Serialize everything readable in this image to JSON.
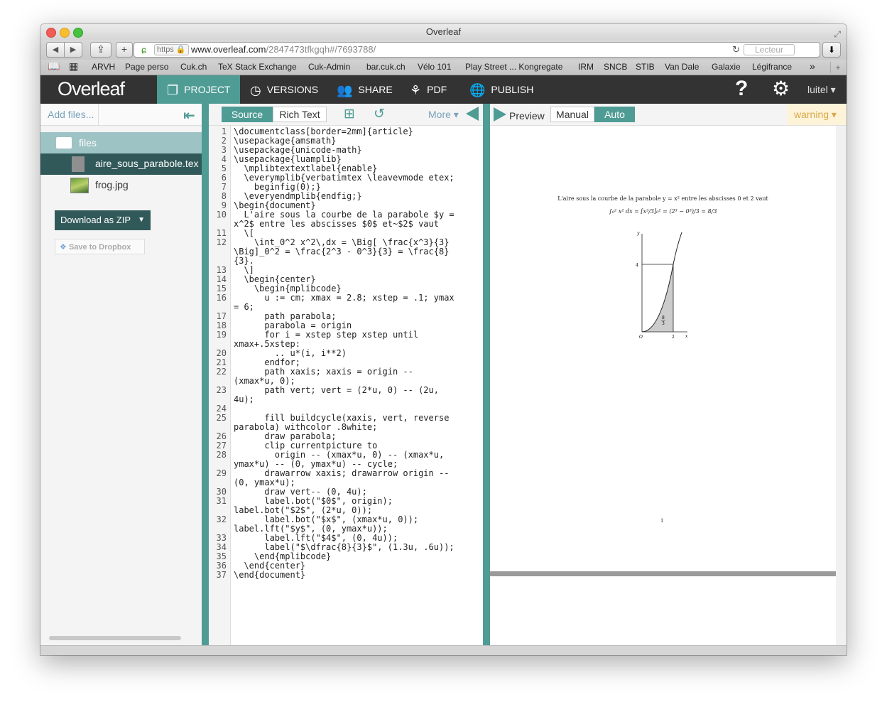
{
  "window": {
    "title": "Overleaf"
  },
  "browser": {
    "url_scheme": "https",
    "url_host": "www.overleaf.com",
    "url_path": "/2847473tfkgqh#/7693788/",
    "reader_label": "Lecteur",
    "bookmarks": [
      "ARVH",
      "Page perso",
      "Cuk.ch",
      "TeX Stack Exchange",
      "Cuk-Admin",
      "bar.cuk.ch",
      "Vélo 101",
      "Play Street ... Kongregate",
      "IRM",
      "SNCB",
      "STIB",
      "Van Dale",
      "Galaxie",
      "Légifrance"
    ]
  },
  "header": {
    "logo": "Overleaf",
    "nav": [
      {
        "label": "PROJECT",
        "icon": "project-icon"
      },
      {
        "label": "VERSIONS",
        "icon": "clock-icon"
      },
      {
        "label": "SHARE",
        "icon": "users-icon"
      },
      {
        "label": "PDF",
        "icon": "pdf-icon"
      },
      {
        "label": "PUBLISH",
        "icon": "globe-icon"
      }
    ],
    "user": "luitel"
  },
  "sidebar": {
    "add_files": "Add files...",
    "folder": "files",
    "files": [
      {
        "name": "aire_sous_parabole.tex",
        "selected": true
      },
      {
        "name": "frog.jpg",
        "selected": false
      }
    ],
    "download_zip": "Download as ZIP",
    "dropbox": "Save to Dropbox"
  },
  "editor": {
    "tab_source": "Source",
    "tab_rich": "Rich Text",
    "more": "More",
    "lines": [
      {
        "n": "1",
        "text": "\\documentclass[border=2mm]{article}"
      },
      {
        "n": "2",
        "text": "\\usepackage{amsmath}"
      },
      {
        "n": "3",
        "text": "\\usepackage{unicode-math}"
      },
      {
        "n": "4",
        "text": "\\usepackage{luamplib}"
      },
      {
        "n": "5",
        "text": "  \\mplibtextextlabel{enable}"
      },
      {
        "n": "6",
        "text": "  \\everymplib{verbatimtex \\leavevmode etex;"
      },
      {
        "n": "7",
        "text": "    beginfig(0);}"
      },
      {
        "n": "8",
        "text": "  \\everyendmplib{endfig;}"
      },
      {
        "n": "9",
        "text": "\\begin{document}"
      },
      {
        "n": "10",
        "text": "  L'aire sous la courbe de la parabole $y ="
      },
      {
        "n": "",
        "text": "x^2$ entre les abscisses $0$ et~$2$ vaut"
      },
      {
        "n": "11",
        "text": "  \\["
      },
      {
        "n": "12",
        "text": "    \\int_0^2 x^2\\,dx = \\Big[ \\frac{x^3}{3}"
      },
      {
        "n": "",
        "text": "\\Big]_0^2 = \\frac{2^3 - 0^3}{3} = \\frac{8}"
      },
      {
        "n": "",
        "text": "{3}."
      },
      {
        "n": "13",
        "text": "  \\]"
      },
      {
        "n": "14",
        "text": "  \\begin{center}"
      },
      {
        "n": "15",
        "text": "    \\begin{mplibcode}"
      },
      {
        "n": "16",
        "text": "      u := cm; xmax = 2.8; xstep = .1; ymax"
      },
      {
        "n": "",
        "text": "= 6;"
      },
      {
        "n": "17",
        "text": "      path parabola;"
      },
      {
        "n": "18",
        "text": "      parabola = origin"
      },
      {
        "n": "19",
        "text": "      for i = xstep step xstep until"
      },
      {
        "n": "",
        "text": "xmax+.5xstep:"
      },
      {
        "n": "20",
        "text": "        .. u*(i, i**2)"
      },
      {
        "n": "21",
        "text": "      endfor;"
      },
      {
        "n": "22",
        "text": "      path xaxis; xaxis = origin --"
      },
      {
        "n": "",
        "text": "(xmax*u, 0);"
      },
      {
        "n": "23",
        "text": "      path vert; vert = (2*u, 0) -- (2u,"
      },
      {
        "n": "",
        "text": "4u);"
      },
      {
        "n": "24",
        "text": ""
      },
      {
        "n": "25",
        "text": "      fill buildcycle(xaxis, vert, reverse"
      },
      {
        "n": "",
        "text": "parabola) withcolor .8white;"
      },
      {
        "n": "26",
        "text": "      draw parabola;"
      },
      {
        "n": "27",
        "text": "      clip currentpicture to"
      },
      {
        "n": "28",
        "text": "        origin -- (xmax*u, 0) -- (xmax*u,"
      },
      {
        "n": "",
        "text": "ymax*u) -- (0, ymax*u) -- cycle;"
      },
      {
        "n": "29",
        "text": "      drawarrow xaxis; drawarrow origin --"
      },
      {
        "n": "",
        "text": "(0, ymax*u);"
      },
      {
        "n": "30",
        "text": "      draw vert-- (0, 4u);"
      },
      {
        "n": "31",
        "text": "      label.bot(\"$0$\", origin);"
      },
      {
        "n": "",
        "text": "label.bot(\"$2$\", (2*u, 0));"
      },
      {
        "n": "32",
        "text": "      label.bot(\"$x$\", (xmax*u, 0));"
      },
      {
        "n": "",
        "text": "label.lft(\"$y$\", (0, ymax*u));"
      },
      {
        "n": "33",
        "text": "      label.lft(\"$4$\", (0, 4u));"
      },
      {
        "n": "34",
        "text": "      label(\"$\\dfrac{8}{3}$\", (1.3u, .6u));"
      },
      {
        "n": "35",
        "text": "    \\end{mplibcode}"
      },
      {
        "n": "36",
        "text": "  \\end{center}"
      },
      {
        "n": "37",
        "text": "\\end{document}"
      }
    ]
  },
  "preview": {
    "label": "Preview",
    "manual": "Manual",
    "auto": "Auto",
    "warning": "warning",
    "caption": "L'aire sous la courbe de la parabole y = x² entre les abscisses 0 et 2 vaut",
    "equation": "∫₀² x² dx = [x³/3]₀² = (2³ − 0³)/3 = 8/3",
    "fig_labels": {
      "y": "y",
      "four": "4",
      "origin": "O",
      "two": "2",
      "x": "x",
      "frac_num": "8",
      "frac_den": "3"
    },
    "page_number": "1"
  }
}
